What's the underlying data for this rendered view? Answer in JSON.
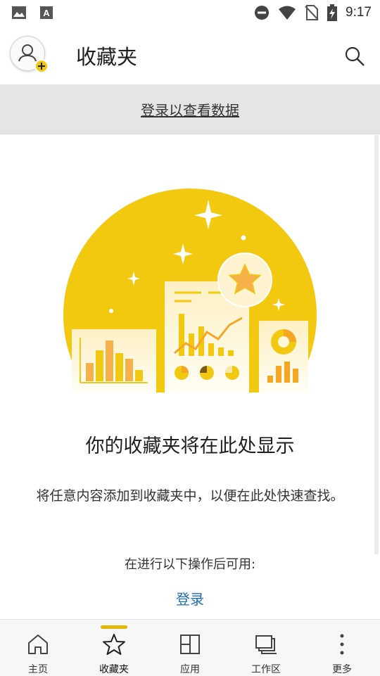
{
  "status_bar": {
    "time": "9:17",
    "icons": [
      "image-icon",
      "font-icon",
      "do-not-disturb-icon",
      "wifi-icon",
      "no-sim-icon",
      "battery-charging-icon"
    ]
  },
  "header": {
    "title": "收藏夹",
    "avatar_icon": "add-user-icon",
    "search_icon": "search-icon"
  },
  "banner": {
    "signin_text": "登录以查看数据"
  },
  "empty_state": {
    "title": "你的收藏夹将在此处显示",
    "description": "将任意内容添加到收藏夹中，以便在此处快速查找。",
    "available_after": "在进行以下操作后可用:",
    "signin_link": "登录"
  },
  "bottom_nav": {
    "items": [
      {
        "label": "主页",
        "icon": "home-icon",
        "active": false
      },
      {
        "label": "收藏夹",
        "icon": "star-icon",
        "active": true
      },
      {
        "label": "应用",
        "icon": "apps-icon",
        "active": false
      },
      {
        "label": "工作区",
        "icon": "workspace-icon",
        "active": false
      },
      {
        "label": "更多",
        "icon": "more-icon",
        "active": false
      }
    ]
  },
  "colors": {
    "accent_yellow": "#f2c811",
    "link_blue": "#1f6fb5",
    "banner_gray": "#e5e5e5"
  }
}
